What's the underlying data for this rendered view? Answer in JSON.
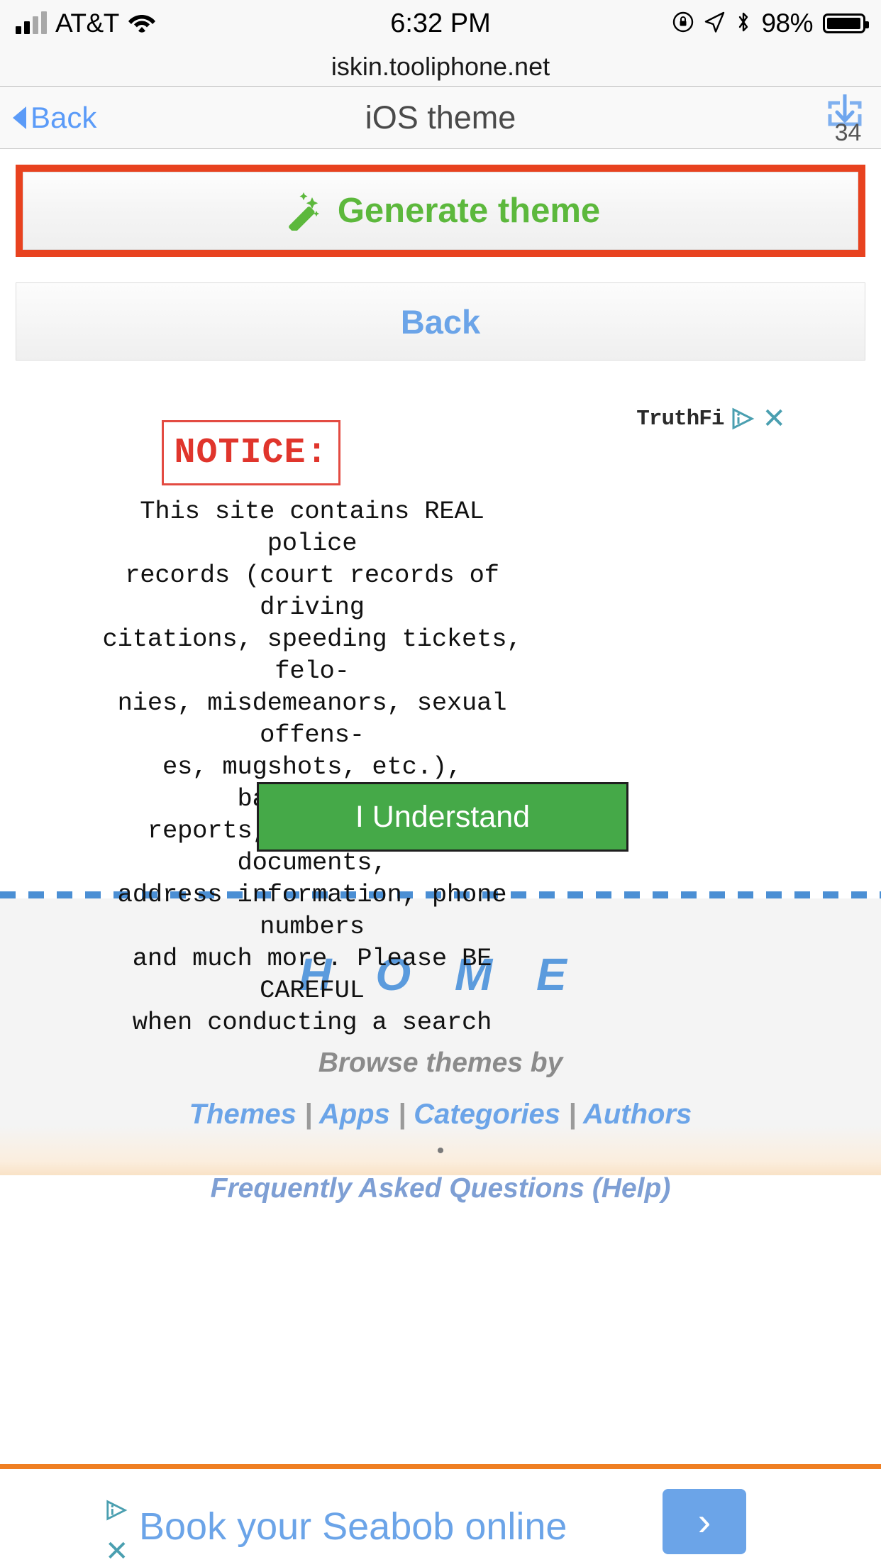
{
  "status_bar": {
    "carrier": "AT&T",
    "time": "6:32 PM",
    "battery_percent": "98%",
    "icons": [
      "signal-bars-icon",
      "wifi-icon",
      "rotation-lock-icon",
      "location-arrow-icon",
      "bluetooth-icon",
      "battery-icon"
    ]
  },
  "url_bar": {
    "url": "iskin.tooliphone.net"
  },
  "nav_bar": {
    "back_label": "Back",
    "title": "iOS theme",
    "download_badge": "34"
  },
  "main": {
    "generate_button": {
      "label": "Generate theme",
      "icon": "magic-wand-icon",
      "text_color": "#5cb83c",
      "highlight_border_color": "#e8421f"
    },
    "back_button": {
      "label": "Back",
      "text_color": "#6ba4e8"
    }
  },
  "ad_notice": {
    "brand": "TruthFi",
    "adchoices_icon": "adchoices-icon",
    "close_icon": "close-icon",
    "heading": "NOTICE:",
    "heading_color": "#e0352c",
    "body": "This site contains REAL police\nrecords (court records of driving\ncitations, speeding tickets, felo-\nnies, misdemeanors, sexual offens-\nes, mugshots, etc.), background\nreports, photos, court documents,\naddress information, phone numbers\nand much more. Please BE CAREFUL\nwhen conducting a search",
    "cta_label": "I Understand",
    "cta_color": "#45a948"
  },
  "footer": {
    "home_title": "H O M E",
    "browse_label": "Browse themes by",
    "links": [
      "Themes",
      "Apps",
      "Categories",
      "Authors"
    ],
    "link_separator": "|",
    "dot": "•",
    "faq_label": "Frequently Asked Questions (Help)",
    "link_color": "#6ba4e8"
  },
  "bottom_banner": {
    "text": "Book your Seabob online",
    "cta_icon": "chevron-right-icon",
    "close_icon": "close-icon",
    "adchoices_icon": "adchoices-icon",
    "accent_color": "#ef7f22"
  }
}
